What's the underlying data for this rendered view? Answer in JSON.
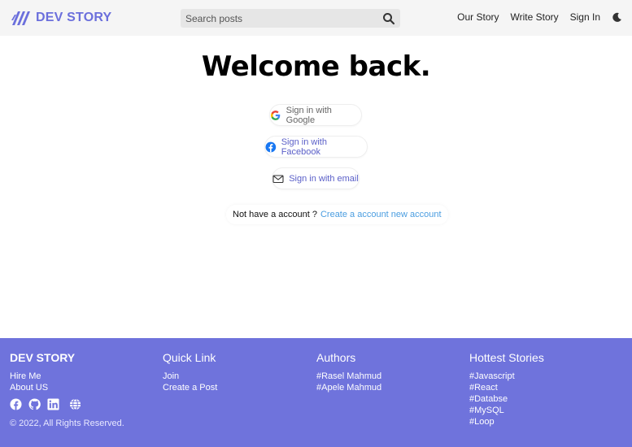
{
  "header": {
    "brand": "DEV STORY",
    "search_placeholder": "Search posts",
    "nav": {
      "our_story": "Our Story",
      "write_story": "Write Story",
      "sign_in": "Sign In"
    }
  },
  "main": {
    "title": "Welcome back.",
    "buttons": {
      "google": "Sign in with Google",
      "facebook": "Sign in with Facebook",
      "email": "Sign in with email"
    },
    "account_prompt": "Not have a account ?",
    "create_account_link": "Create a account new account"
  },
  "footer": {
    "brand": "DEV STORY",
    "brand_links": [
      "Hire Me",
      "About US"
    ],
    "copyright": "© 2022, All Rights Reserved.",
    "quick_link": {
      "title": "Quick Link",
      "links": [
        "Join",
        "Create a Post"
      ]
    },
    "authors": {
      "title": "Authors",
      "links": [
        "#Rasel Mahmud",
        "#Apele Mahmud"
      ]
    },
    "hottest": {
      "title": "Hottest Stories",
      "links": [
        "#Javascript",
        "#React",
        "#Databse",
        "#MySQL",
        "#Loop"
      ]
    },
    "social_icons": [
      "facebook-icon",
      "github-icon",
      "linkedin-icon",
      "globe-icon"
    ]
  },
  "colors": {
    "brand": "#6b6fdc",
    "footer_bg": "#6f73dc",
    "link": "#4a9de0"
  }
}
